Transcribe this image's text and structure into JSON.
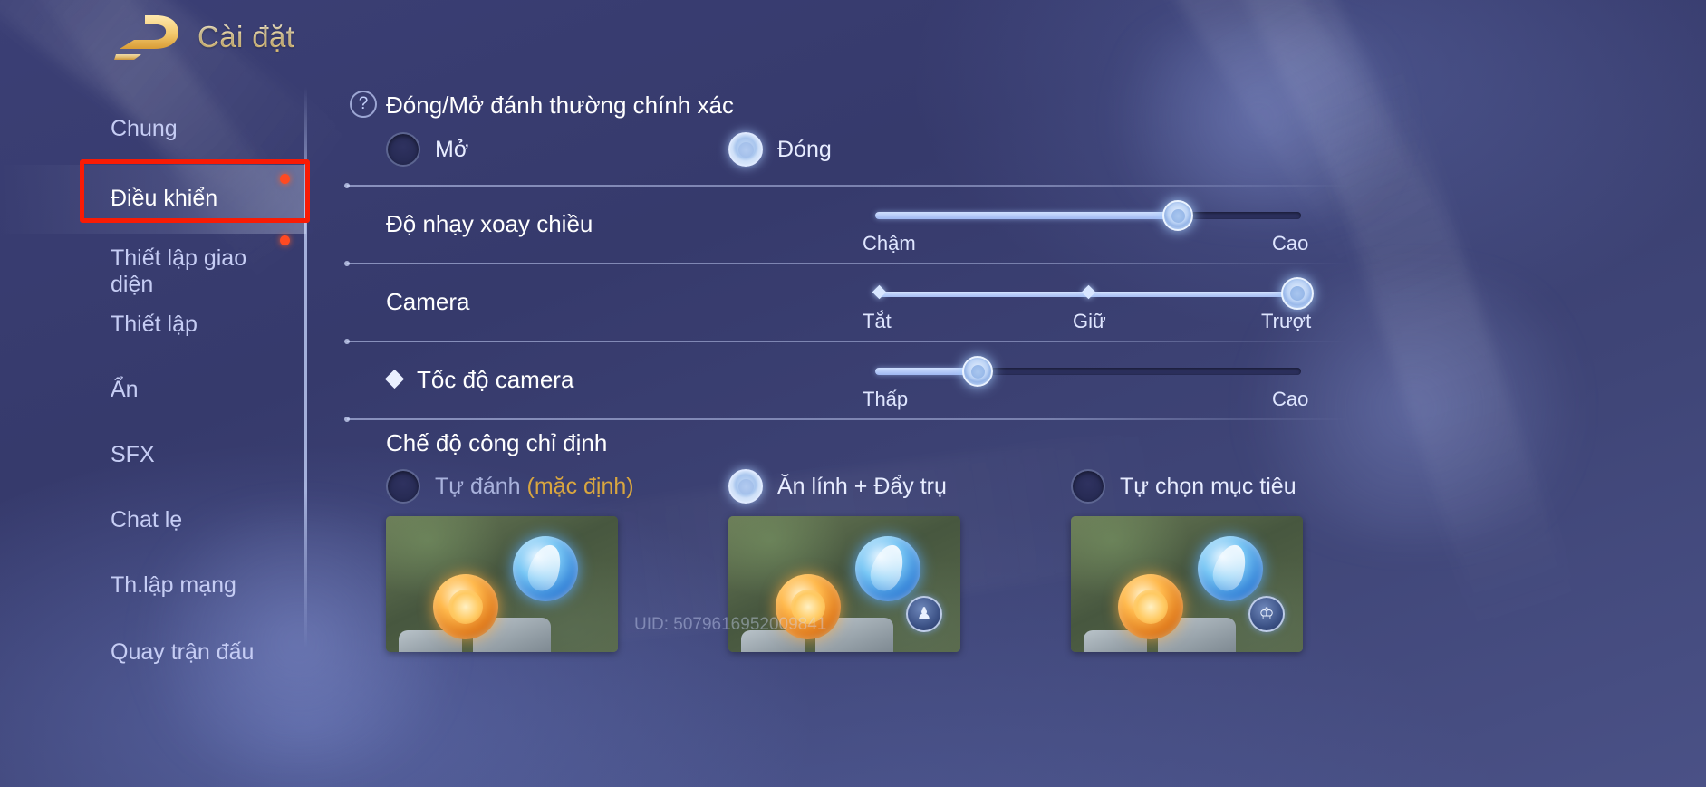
{
  "header": {
    "title": "Cài đặt",
    "logo_icon": "game-logo-icon"
  },
  "sidebar": {
    "items": [
      {
        "label": "Chung",
        "active": false,
        "badge": false
      },
      {
        "label": "Điều khiển",
        "active": true,
        "badge": true
      },
      {
        "label": "Thiết lập giao diện",
        "active": false,
        "badge": true
      },
      {
        "label": "Thiết lập",
        "active": false,
        "badge": false
      },
      {
        "label": "Ẩn",
        "active": false,
        "badge": false
      },
      {
        "label": "SFX",
        "active": false,
        "badge": false
      },
      {
        "label": "Chat lẹ",
        "active": false,
        "badge": false
      },
      {
        "label": "Th.lập mạng",
        "active": false,
        "badge": false
      },
      {
        "label": "Quay trận đấu",
        "active": false,
        "badge": false
      }
    ]
  },
  "main": {
    "basic_attack": {
      "help_icon": "question-mark-icon",
      "title": "Đóng/Mở đánh thường chính xác",
      "options": [
        {
          "label": "Mở",
          "selected": false
        },
        {
          "label": "Đóng",
          "selected": true
        }
      ]
    },
    "rotation_sensitivity": {
      "label": "Độ nhạy xoay chiều",
      "min_label": "Chậm",
      "max_label": "Cao",
      "value_percent": 71
    },
    "camera": {
      "label": "Camera",
      "steps": [
        "Tắt",
        "Giữ",
        "Trượt"
      ],
      "selected_index": 2
    },
    "camera_speed": {
      "bullet_icon": "diamond-bullet-icon",
      "label": "Tốc độ camera",
      "min_label": "Thấp",
      "max_label": "Cao",
      "value_percent": 24
    },
    "attack_mode": {
      "title": "Chế độ công chỉ định",
      "options": [
        {
          "label": "Tự đánh",
          "suffix": "(mặc định)",
          "selected": false,
          "badge_icon": "none"
        },
        {
          "label": "Ăn lính + Đẩy trụ",
          "suffix": "",
          "selected": true,
          "badge_icon": "tower-icon"
        },
        {
          "label": "Tự chọn mục tiêu",
          "suffix": "",
          "selected": false,
          "badge_icon": "helmet-icon"
        }
      ]
    }
  },
  "watermark": {
    "text": "UID: 5079616952009841"
  },
  "annotation": {
    "highlight_color": "#f81b05"
  },
  "colors": {
    "accent_gold": "#f4cf7c",
    "badge_red": "#ff4a22",
    "slider_fill": "#bcd3f5",
    "panel_bg": "#3b3f75"
  }
}
